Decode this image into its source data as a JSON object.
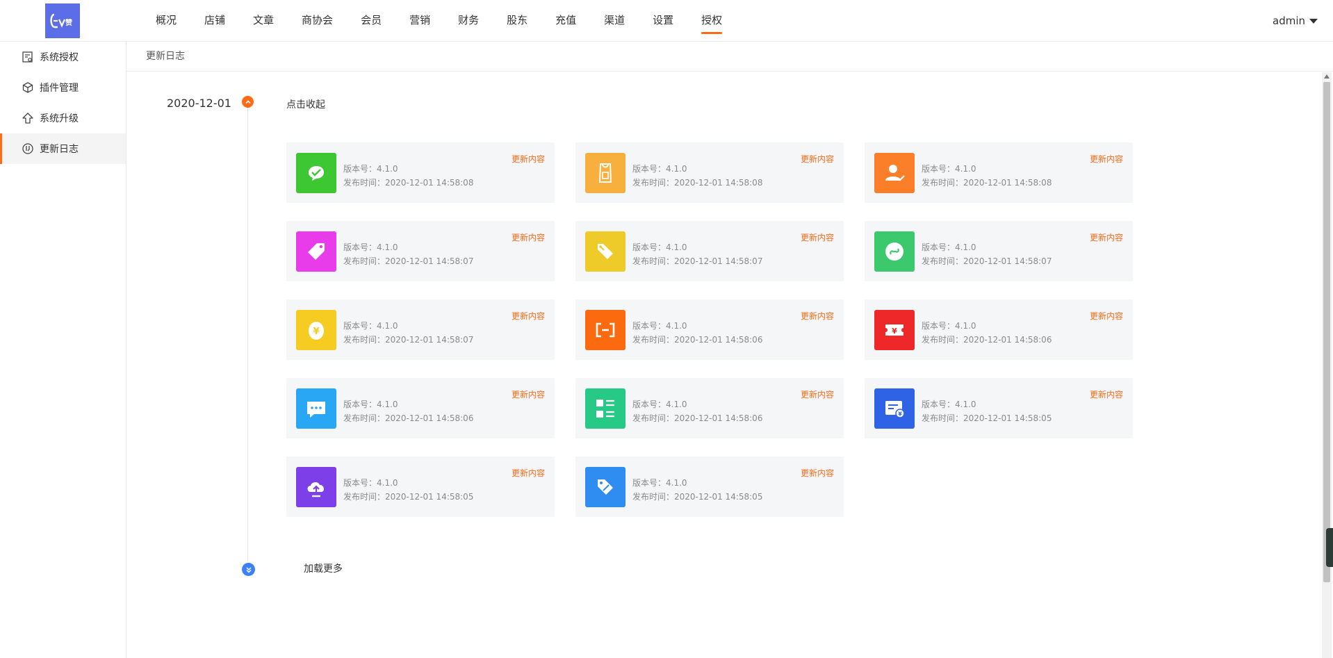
{
  "logo": {
    "text": "EV赞"
  },
  "nav": {
    "items": [
      "概况",
      "店铺",
      "文章",
      "商协会",
      "会员",
      "营销",
      "财务",
      "股东",
      "充值",
      "渠道",
      "设置",
      "授权"
    ],
    "active": 11
  },
  "user": {
    "name": "admin"
  },
  "sidebar": {
    "items": [
      {
        "label": "系统授权",
        "icon": "certificate-icon"
      },
      {
        "label": "插件管理",
        "icon": "cube-icon"
      },
      {
        "label": "系统升级",
        "icon": "upload-arrow-icon"
      },
      {
        "label": "更新日志",
        "icon": "clock-icon"
      }
    ],
    "active": 3
  },
  "breadcrumb": "更新日志",
  "timeline": {
    "date": "2020-12-01",
    "collapse_label": "点击收起",
    "load_more_label": "加载更多"
  },
  "cards": [
    {
      "icon": "wechat-check-icon",
      "color": "#3dc833",
      "version": "版本号：4.1.0",
      "time": "发布时间：2020-12-01 14:58:08",
      "link": "更新内容"
    },
    {
      "icon": "shopping-bag-icon",
      "color": "#f7b03d",
      "version": "版本号：4.1.0",
      "time": "发布时间：2020-12-01 14:58:08",
      "link": "更新内容"
    },
    {
      "icon": "user-check-icon",
      "color": "#fa7f28",
      "version": "版本号：4.1.0",
      "time": "发布时间：2020-12-01 14:58:08",
      "link": "更新内容"
    },
    {
      "icon": "tag-icon",
      "color": "#e83bea",
      "version": "版本号：4.1.0",
      "time": "发布时间：2020-12-01 14:58:07",
      "link": "更新内容"
    },
    {
      "icon": "price-tags-icon",
      "color": "#eecb28",
      "version": "版本号：4.1.0",
      "time": "发布时间：2020-12-01 14:58:07",
      "link": "更新内容"
    },
    {
      "icon": "mini-program-icon",
      "color": "#3cc96e",
      "version": "版本号：4.1.0",
      "time": "发布时间：2020-12-01 14:58:07",
      "link": "更新内容"
    },
    {
      "icon": "money-egg-icon",
      "color": "#f7cc22",
      "version": "版本号：4.1.0",
      "time": "发布时间：2020-12-01 14:58:07",
      "link": "更新内容"
    },
    {
      "icon": "aliyun-icon",
      "color": "#fb6a0e",
      "version": "版本号：4.1.0",
      "time": "发布时间：2020-12-01 14:58:06",
      "link": "更新内容"
    },
    {
      "icon": "coupon-icon",
      "color": "#ee2828",
      "version": "版本号：4.1.0",
      "time": "发布时间：2020-12-01 14:58:06",
      "link": "更新内容"
    },
    {
      "icon": "chat-bubble-icon",
      "color": "#29a7f5",
      "version": "版本号：4.1.0",
      "time": "发布时间：2020-12-01 14:58:06",
      "link": "更新内容"
    },
    {
      "icon": "list-grid-icon",
      "color": "#26c985",
      "version": "版本号：4.1.0",
      "time": "发布时间：2020-12-01 14:58:06",
      "link": "更新内容"
    },
    {
      "icon": "invoice-icon",
      "color": "#2f63e6",
      "version": "版本号：4.1.0",
      "time": "发布时间：2020-12-01 14:58:05",
      "link": "更新内容"
    },
    {
      "icon": "cloud-upload-icon",
      "color": "#7d40e8",
      "version": "版本号：4.1.0",
      "time": "发布时间：2020-12-01 14:58:05",
      "link": "更新内容"
    },
    {
      "icon": "discount-tag-icon",
      "color": "#2f8cf0",
      "version": "版本号：4.1.0",
      "time": "发布时间：2020-12-01 14:58:05",
      "link": "更新内容"
    }
  ],
  "colors": {
    "accent": "#ff6a16",
    "node_blue": "#3b82f6",
    "logo_bg": "#5b6ee8"
  }
}
